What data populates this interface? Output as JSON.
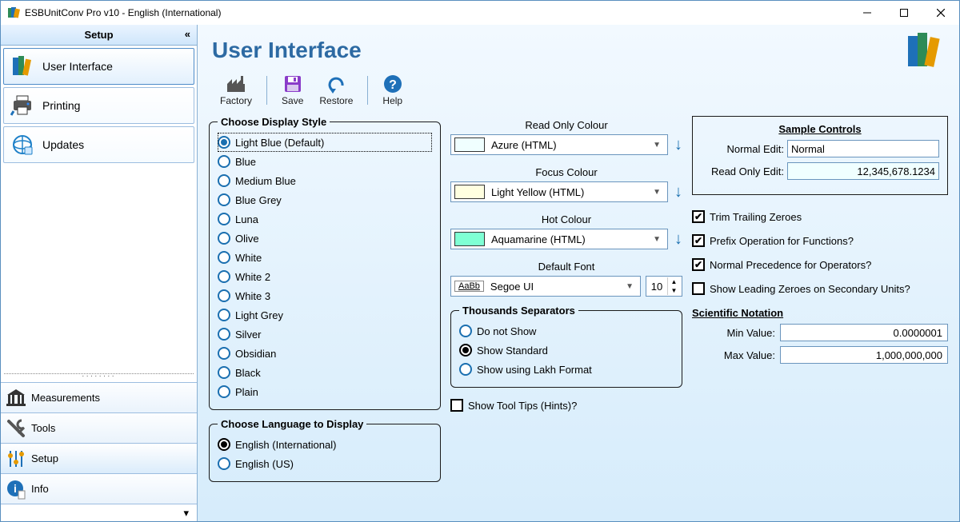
{
  "window": {
    "title": "ESBUnitConv Pro v10 - English (International)"
  },
  "sidebar": {
    "header": "Setup",
    "items": [
      {
        "label": "User Interface"
      },
      {
        "label": "Printing"
      },
      {
        "label": "Updates"
      }
    ],
    "categories": [
      {
        "label": "Measurements"
      },
      {
        "label": "Tools"
      },
      {
        "label": "Setup"
      },
      {
        "label": "Info"
      }
    ]
  },
  "page": {
    "title": "User Interface"
  },
  "toolbar": {
    "factory": "Factory",
    "save": "Save",
    "restore": "Restore",
    "help": "Help"
  },
  "display_style": {
    "legend": "Choose Display Style",
    "options": [
      "Light Blue (Default)",
      "Blue",
      "Medium Blue",
      "Blue Grey",
      "Luna",
      "Olive",
      "White",
      "White 2",
      "White 3",
      "Light Grey",
      "Silver",
      "Obsidian",
      "Black",
      "Plain"
    ],
    "selected": 0
  },
  "language": {
    "legend": "Choose Language to Display",
    "options": [
      "English (International)",
      "English (US)"
    ],
    "selected": 0
  },
  "colours": {
    "read_only": {
      "label": "Read Only Colour",
      "value": "Azure (HTML)",
      "swatch": "#f0ffff"
    },
    "focus": {
      "label": "Focus Colour",
      "value": "Light Yellow (HTML)",
      "swatch": "#ffffe0"
    },
    "hot": {
      "label": "Hot Colour",
      "value": "Aquamarine (HTML)",
      "swatch": "#7fffd4"
    }
  },
  "font": {
    "label": "Default Font",
    "value": "Segoe UI",
    "size": "10"
  },
  "thousands": {
    "legend": "Thousands Separators",
    "options": [
      "Do not Show",
      "Show Standard",
      "Show using Lakh Format"
    ],
    "selected": 1
  },
  "tooltips": {
    "label": "Show Tool Tips (Hints)?",
    "checked": false
  },
  "sample": {
    "title": "Sample Controls",
    "normal_label": "Normal Edit:",
    "normal_value": "Normal",
    "readonly_label": "Read Only Edit:",
    "readonly_value": "12,345,678.1234"
  },
  "checks": {
    "trim": {
      "label": "Trim Trailing Zeroes",
      "checked": true
    },
    "prefix": {
      "label": "Prefix Operation for Functions?",
      "checked": true
    },
    "prec": {
      "label": "Normal Precedence for Operators?",
      "checked": true
    },
    "leadz": {
      "label": "Show Leading Zeroes on Secondary Units?",
      "checked": false
    }
  },
  "scientific": {
    "title": "Scientific Notation",
    "min_label": "Min Value:",
    "min_value": "0.0000001",
    "max_label": "Max Value:",
    "max_value": "1,000,000,000"
  }
}
